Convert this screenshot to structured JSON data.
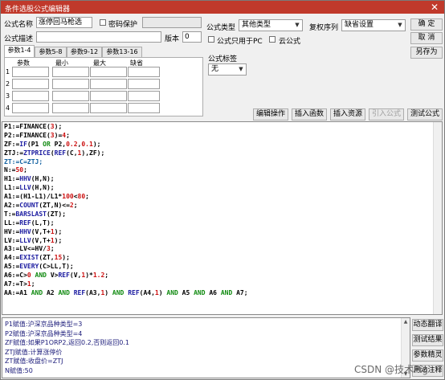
{
  "window": {
    "title": "条件选股公式编辑器",
    "close_glyph": "✕"
  },
  "form": {
    "name_label": "公式名称",
    "name_value": "涨停回马枪选",
    "password_label": "密码保护",
    "desc_label": "公式描述",
    "desc_value": "",
    "version_label": "版本",
    "version_value": "0",
    "type_label": "公式类型",
    "type_value": "其他类型",
    "reweight_label": "复权序列",
    "reweight_value": "缺省设置",
    "pc_only_label": "公式只用于PC",
    "cloud_label": "云公式",
    "tag_label": "公式标签",
    "tag_value": "无"
  },
  "buttons": {
    "ok": "确  定",
    "cancel": "取  消",
    "save_as": "另存为",
    "edit_ops": "编辑操作",
    "insert_func": "插入函数",
    "insert_res": "插入资源",
    "import_formula": "引入公式",
    "test_formula": "测试公式",
    "translate": "动态翻译",
    "test_result": "测试结果",
    "param_wizard": "参数精灵",
    "usage_notes": "用法注释"
  },
  "param_tabs": [
    "参数1-4",
    "参数5-8",
    "参数9-12",
    "参数13-16"
  ],
  "param_headers": [
    "参数",
    "最小",
    "最大",
    "缺省"
  ],
  "param_rows": [
    "1",
    "2",
    "3",
    "4"
  ],
  "code_lines": [
    [
      [
        "P1:=FINANCE(",
        "k"
      ],
      [
        "3",
        "r"
      ],
      [
        ");",
        "k"
      ]
    ],
    [
      [
        "P2:=FINANCE(",
        "k"
      ],
      [
        "3",
        "r"
      ],
      [
        ")=",
        "k"
      ],
      [
        "4",
        "r"
      ],
      [
        ";",
        "k"
      ]
    ],
    [
      [
        "ZF:=",
        "k"
      ],
      [
        "IF",
        "b"
      ],
      [
        "(P1 ",
        "k"
      ],
      [
        "OR",
        "g"
      ],
      [
        " P2,",
        "k"
      ],
      [
        "0.2",
        "r"
      ],
      [
        ",",
        "k"
      ],
      [
        "0.1",
        "r"
      ],
      [
        ");",
        "k"
      ]
    ],
    [
      [
        "ZTJ:=",
        "k"
      ],
      [
        "ZTPRICE",
        "b"
      ],
      [
        "(",
        "k"
      ],
      [
        "REF",
        "b"
      ],
      [
        "(C,",
        "k"
      ],
      [
        "1",
        "r"
      ],
      [
        "),ZF);",
        "k"
      ]
    ],
    [
      [
        "ZT:=C=ZTJ;",
        "c"
      ]
    ],
    [
      [
        "N:=",
        "k"
      ],
      [
        "50",
        "r"
      ],
      [
        ";",
        "k"
      ]
    ],
    [
      [
        "H1:=",
        "k"
      ],
      [
        "HHV",
        "b"
      ],
      [
        "(H,N);",
        "k"
      ]
    ],
    [
      [
        "L1:=",
        "k"
      ],
      [
        "LLV",
        "b"
      ],
      [
        "(H,N);",
        "k"
      ]
    ],
    [
      [
        "A1:=(H1-L1)/L1*",
        "k"
      ],
      [
        "100",
        "r"
      ],
      [
        "<",
        "k"
      ],
      [
        "80",
        "r"
      ],
      [
        ";",
        "k"
      ]
    ],
    [
      [
        "A2:=",
        "k"
      ],
      [
        "COUNT",
        "b"
      ],
      [
        "(ZT,N)<=",
        "k"
      ],
      [
        "2",
        "r"
      ],
      [
        ";",
        "k"
      ]
    ],
    [
      [
        "T:=",
        "k"
      ],
      [
        "BARSLAST",
        "b"
      ],
      [
        "(ZT);",
        "k"
      ]
    ],
    [
      [
        "LL:=",
        "k"
      ],
      [
        "REF",
        "b"
      ],
      [
        "(L,T);",
        "k"
      ]
    ],
    [
      [
        "HV:=",
        "k"
      ],
      [
        "HHV",
        "b"
      ],
      [
        "(V,T+",
        "k"
      ],
      [
        "1",
        "r"
      ],
      [
        ");",
        "k"
      ]
    ],
    [
      [
        "LV:=",
        "k"
      ],
      [
        "LLV",
        "b"
      ],
      [
        "(V,T+",
        "k"
      ],
      [
        "1",
        "r"
      ],
      [
        ");",
        "k"
      ]
    ],
    [
      [
        "A3:=LV<=HV/",
        "k"
      ],
      [
        "3",
        "r"
      ],
      [
        ";",
        "k"
      ]
    ],
    [
      [
        "A4:=",
        "k"
      ],
      [
        "EXIST",
        "b"
      ],
      [
        "(ZT,",
        "k"
      ],
      [
        "15",
        "r"
      ],
      [
        ");",
        "k"
      ]
    ],
    [
      [
        "A5:=",
        "k"
      ],
      [
        "EVERY",
        "b"
      ],
      [
        "(C>LL,T);",
        "k"
      ]
    ],
    [
      [
        "A6:=C>",
        "k"
      ],
      [
        "0",
        "r"
      ],
      [
        " AND ",
        "g"
      ],
      [
        "V>",
        "k"
      ],
      [
        "REF",
        "b"
      ],
      [
        "(V,",
        "k"
      ],
      [
        "1",
        "r"
      ],
      [
        ")*",
        "k"
      ],
      [
        "1.2",
        "r"
      ],
      [
        ";",
        "k"
      ]
    ],
    [
      [
        "A7:=T>",
        "k"
      ],
      [
        "1",
        "r"
      ],
      [
        ";",
        "k"
      ]
    ],
    [
      [
        "AA:=A1 ",
        "k"
      ],
      [
        "AND",
        "g"
      ],
      [
        " A2 ",
        "k"
      ],
      [
        "AND",
        "g"
      ],
      [
        " ",
        "k"
      ],
      [
        "REF",
        "b"
      ],
      [
        "(A3,",
        "k"
      ],
      [
        "1",
        "r"
      ],
      [
        ") ",
        "k"
      ],
      [
        "AND",
        "g"
      ],
      [
        " ",
        "k"
      ],
      [
        "REF",
        "b"
      ],
      [
        "(A4,",
        "k"
      ],
      [
        "1",
        "r"
      ],
      [
        ") ",
        "k"
      ],
      [
        "AND",
        "g"
      ],
      [
        " A5 ",
        "k"
      ],
      [
        "AND",
        "g"
      ],
      [
        " A6 ",
        "k"
      ],
      [
        "AND",
        "g"
      ],
      [
        " A7;",
        "k"
      ]
    ]
  ],
  "output_lines": [
    "P1赋值:沪深京品种类型=3",
    "P2赋值:沪深京品种类型=4",
    "ZF赋值:如果P1ORP2,返回0.2,否则返回0.1",
    "ZTJ赋值:计算涨停价",
    "ZT赋值:收盘价=ZTJ",
    "N赋值:50"
  ],
  "watermark": "CSDN @技术Pig",
  "colors": {
    "titlebar": "#c0392b",
    "function": "#1a1aa0",
    "keyword": "#108a10",
    "number": "#cc1010"
  }
}
